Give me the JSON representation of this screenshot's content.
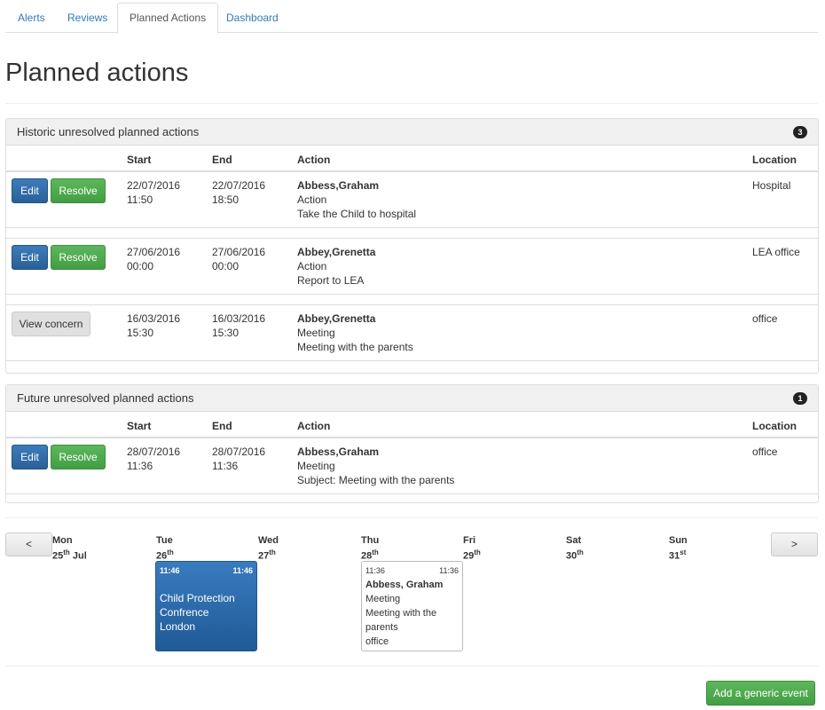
{
  "tabs": [
    "Alerts",
    "Reviews",
    "Planned Actions",
    "Dashboard"
  ],
  "page_title": "Planned actions",
  "columns": {
    "start": "Start",
    "end": "End",
    "action": "Action",
    "location": "Location"
  },
  "buttons": {
    "edit": "Edit",
    "resolve": "Resolve",
    "view_concern": "View concern",
    "prev": "<",
    "next": ">",
    "add_generic_event": "Add a generic event"
  },
  "historic": {
    "title": "Historic unresolved planned actions",
    "count": "3",
    "rows": [
      {
        "start_date": "22/07/2016",
        "start_time": "11:50",
        "end_date": "22/07/2016",
        "end_time": "18:50",
        "name": "Abbess,Graham",
        "type": "Action",
        "detail": "Take the Child to hospital",
        "location": "Hospital"
      },
      {
        "start_date": "27/06/2016",
        "start_time": "00:00",
        "end_date": "27/06/2016",
        "end_time": "00:00",
        "name": "Abbey,Grenetta",
        "type": "Action",
        "detail": "Report to LEA",
        "location": "LEA office"
      },
      {
        "start_date": "16/03/2016",
        "start_time": "15:30",
        "end_date": "16/03/2016",
        "end_time": "15:30",
        "name": "Abbey,Grenetta",
        "type": "Meeting",
        "detail": "Meeting with the parents",
        "location": "office"
      }
    ]
  },
  "future": {
    "title": "Future unresolved planned actions",
    "count": "1",
    "rows": [
      {
        "start_date": "28/07/2016",
        "start_time": "11:36",
        "end_date": "28/07/2016",
        "end_time": "11:36",
        "name": "Abbess,Graham",
        "type": "Meeting",
        "detail": "Subject: Meeting with the parents",
        "location": "office"
      }
    ]
  },
  "calendar": {
    "days": [
      {
        "name": "Mon",
        "date": "25",
        "suffix": "th",
        "month": "Jul"
      },
      {
        "name": "Tue",
        "date": "26",
        "suffix": "th",
        "month": ""
      },
      {
        "name": "Wed",
        "date": "27",
        "suffix": "th",
        "month": ""
      },
      {
        "name": "Thu",
        "date": "28",
        "suffix": "th",
        "month": ""
      },
      {
        "name": "Fri",
        "date": "29",
        "suffix": "th",
        "month": ""
      },
      {
        "name": "Sat",
        "date": "30",
        "suffix": "th",
        "month": ""
      },
      {
        "name": "Sun",
        "date": "31",
        "suffix": "st",
        "month": ""
      }
    ],
    "events": [
      {
        "start": "11:46",
        "end": "11:46",
        "lines": [
          "Child Protection",
          "Confrence",
          "London"
        ]
      },
      {
        "start": "11:36",
        "end": "11:36",
        "title": "Abbess, Graham",
        "lines": [
          "Meeting",
          "Meeting with the",
          "parents",
          "office"
        ]
      }
    ]
  },
  "colors": {
    "primary": "#2a6099",
    "success": "#449d44",
    "link": "#337ab7"
  }
}
